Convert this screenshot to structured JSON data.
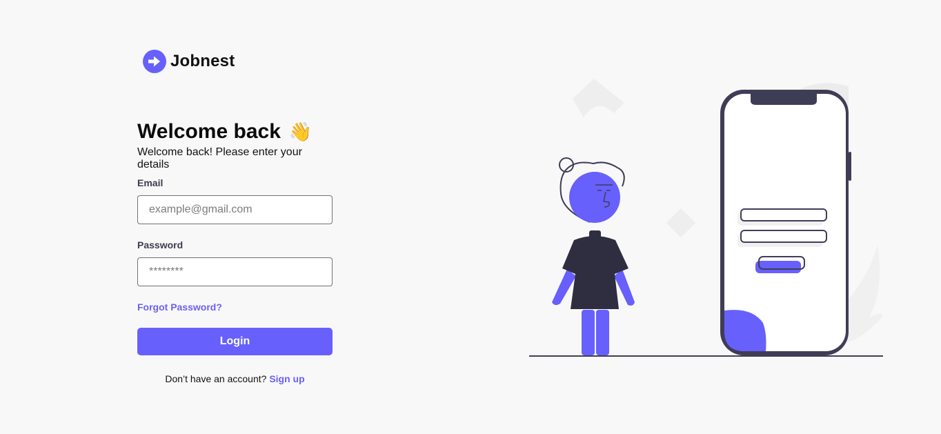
{
  "brand": {
    "name": "Jobnest",
    "icon": "arrow-circle-right-icon",
    "accent_color": "#6760fd"
  },
  "login": {
    "title": "Welcome back",
    "wave_emoji": "👋",
    "subtitle": "Welcome back! Please enter your details",
    "email": {
      "label": "Email",
      "placeholder": "example@gmail.com",
      "value": ""
    },
    "password": {
      "label": "Password",
      "placeholder": "********",
      "value": ""
    },
    "forgot_password": "Forgot Password?",
    "login_button": "Login",
    "signup_prompt": "Don’t have an account?",
    "signup_link": "Sign up"
  },
  "illustration": {
    "name": "person-with-phone-login-illustration",
    "colors": {
      "primary": "#6760fd",
      "dark": "#3f3d56",
      "light": "#efefef"
    }
  }
}
